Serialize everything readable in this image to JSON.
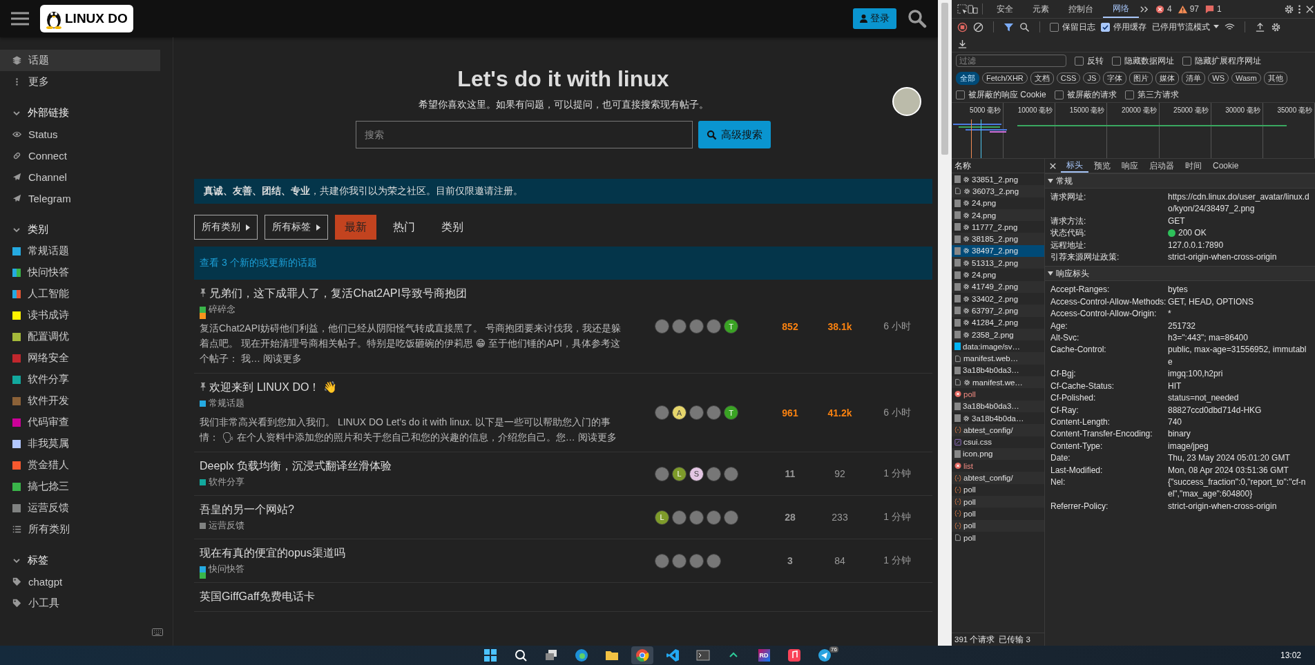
{
  "header": {
    "logo_text": "LINUX DO",
    "login_button": "登录"
  },
  "sidebar": {
    "items": [
      {
        "label": "话题",
        "kind": "layers",
        "selected": true
      },
      {
        "label": "更多",
        "kind": "dots",
        "selected": false
      }
    ],
    "sections": [
      {
        "title": "外部链接",
        "expanded": true,
        "items": [
          {
            "label": "Status",
            "kind": "eye"
          },
          {
            "label": "Connect",
            "kind": "link"
          },
          {
            "label": "Channel",
            "kind": "plane"
          },
          {
            "label": "Telegram",
            "kind": "plane"
          }
        ]
      },
      {
        "title": "类别",
        "expanded": true,
        "items": [
          {
            "label": "常规话题",
            "color": "#25aae1"
          },
          {
            "label": "快问快答",
            "stripes": [
              {
                "color": "#25aae1"
              },
              {
                "color": "#3ab54a"
              }
            ]
          },
          {
            "label": "人工智能",
            "stripes": [
              {
                "color": "#25aae1"
              },
              {
                "color": "#e45735"
              }
            ]
          },
          {
            "label": "读书成诗",
            "color": "#fff200"
          },
          {
            "label": "配置调优",
            "color": "#a4b83a"
          },
          {
            "label": "网络安全",
            "color": "#c1272d"
          },
          {
            "label": "软件分享",
            "color": "#12a89d"
          },
          {
            "label": "软件开发",
            "color": "#8c6238"
          },
          {
            "label": "代码审查",
            "color": "#cc0099"
          },
          {
            "label": "非我莫属",
            "color": "#b3c8ff"
          },
          {
            "label": "赏金猎人",
            "color": "#f7592f"
          },
          {
            "label": "搞七捻三",
            "color": "#3ab54a"
          },
          {
            "label": "运营反馈",
            "color": "#808281"
          },
          {
            "label": "所有类别",
            "kind": "list"
          }
        ]
      },
      {
        "title": "标签",
        "expanded": true,
        "items": [
          {
            "label": "chatgpt",
            "kind": "tag"
          },
          {
            "label": "小工具",
            "kind": "tag"
          }
        ]
      }
    ]
  },
  "hero": {
    "title": "Let's do it with linux",
    "subtitle": "希望你喜欢这里。如果有问题，可以提问，也可直接搜索现有帖子。",
    "search_placeholder": "搜索",
    "search_button": "高级搜索"
  },
  "banner": "**真诚、友善、团结、专业**，共建你我引以为荣之社区。目前仅限邀请注册。",
  "nav": {
    "dropdowns": [
      "所有类别",
      "所有标签"
    ],
    "tabs": [
      {
        "label": "最新",
        "selected": true
      },
      {
        "label": "热门",
        "selected": false
      },
      {
        "label": "类别",
        "selected": false
      }
    ]
  },
  "new_topics": "查看 3 个新的或更新的话题",
  "topics": [
    {
      "title": "兄弟们，这下成罪人了，复活Chat2API导致号商抱团",
      "pinned": true,
      "category": "碎碎念",
      "stripes": [
        {
          "color": "#3ab54a"
        },
        {
          "color": "#f7941d"
        }
      ],
      "excerpt": "复活Chat2API妨碍他们利益，他们已经从阴阳怪气转成直接黑了。 号商抱团要来讨伐我，我还是躲着点吧。 现在开始清理号商相关帖子。特别是吃饭砸碗的伊莉思 😁 至于他们锤的API，具体参考这个帖子： 我…",
      "read_more": "阅读更多",
      "avatars": [
        {
          "kind": "image"
        },
        {
          "kind": "image"
        },
        {
          "kind": "image"
        },
        {
          "kind": "image"
        },
        {
          "kind": "letter",
          "letter": "T",
          "color": "#3aa324"
        }
      ],
      "replies": "852",
      "views": "38.1k",
      "activity": "6 小时",
      "hot": true
    },
    {
      "title": "欢迎来到 LINUX DO！ 👋",
      "pinned": true,
      "category": "常规话题",
      "color": "#25aae1",
      "excerpt": "我们非常高兴看到您加入我们。 LINUX DO Let’s do it with linux. 以下是一些可以帮助您入门的事情： 🗣 在个人资料中添加您的照片和关于您自己和您的兴趣的信息，介绍您自己。您…",
      "read_more": "阅读更多",
      "avatars": [
        {
          "kind": "image"
        },
        {
          "kind": "letter",
          "letter": "A",
          "color": "#e5d56b"
        },
        {
          "kind": "image"
        },
        {
          "kind": "image"
        },
        {
          "kind": "letter",
          "letter": "T",
          "color": "#3aa324"
        }
      ],
      "replies": "961",
      "views": "41.2k",
      "activity": "6 小时",
      "hot": true
    },
    {
      "title": "Deeplx 负载均衡，沉浸式翻译丝滑体验",
      "pinned": false,
      "category": "软件分享",
      "color": "#12a89d",
      "avatars": [
        {
          "kind": "image"
        },
        {
          "kind": "letter",
          "letter": "L",
          "color": "#7e9b2a"
        },
        {
          "kind": "letter",
          "letter": "S",
          "color": "#e3c6e3"
        },
        {
          "kind": "image"
        },
        {
          "kind": "image"
        }
      ],
      "replies": "11",
      "views": "92",
      "activity": "1 分钟",
      "hot": false
    },
    {
      "title": "吾皇的另一个网站?",
      "pinned": false,
      "category": "运营反馈",
      "color": "#808281",
      "avatars": [
        {
          "kind": "letter",
          "letter": "L",
          "color": "#7e9b2a"
        },
        {
          "kind": "image"
        },
        {
          "kind": "image"
        },
        {
          "kind": "image"
        },
        {
          "kind": "image"
        }
      ],
      "replies": "28",
      "views": "233",
      "activity": "1 分钟",
      "hot": false
    },
    {
      "title": "现在有真的便宜的opus渠道吗",
      "pinned": false,
      "category": "快问快答",
      "stripes": [
        {
          "color": "#25aae1"
        },
        {
          "color": "#3ab54a"
        }
      ],
      "avatars": [
        {
          "kind": "image"
        },
        {
          "kind": "image"
        },
        {
          "kind": "image"
        },
        {
          "kind": "image"
        }
      ],
      "replies": "3",
      "views": "84",
      "activity": "1 分钟",
      "hot": false
    },
    {
      "title": "英国GiffGaff免费电话卡",
      "pinned": false
    }
  ],
  "devtools": {
    "tabs": [
      {
        "label": "安全",
        "selected": false
      },
      {
        "label": "元素",
        "selected": false
      },
      {
        "label": "控制台",
        "selected": false
      },
      {
        "label": "网络",
        "selected": true
      }
    ],
    "errors": "4",
    "warnings": "97",
    "issues": "1",
    "options": [
      {
        "label": "保留日志",
        "checked": false
      },
      {
        "label": "停用缓存",
        "checked": true
      }
    ],
    "throttling": "已停用节流模式",
    "filter_placeholder": "过滤",
    "filter_options": [
      {
        "label": "反转",
        "checked": false
      },
      {
        "label": "隐藏数据网址",
        "checked": false
      },
      {
        "label": "隐藏扩展程序网址",
        "checked": false
      }
    ],
    "types": [
      {
        "label": "全部",
        "selected": true
      },
      {
        "label": "Fetch/XHR",
        "selected": false
      },
      {
        "label": "文档",
        "selected": false
      },
      {
        "label": "CSS",
        "selected": false
      },
      {
        "label": "JS",
        "selected": false
      },
      {
        "label": "字体",
        "selected": false
      },
      {
        "label": "图片",
        "selected": false
      },
      {
        "label": "媒体",
        "selected": false
      },
      {
        "label": "清单",
        "selected": false
      },
      {
        "label": "WS",
        "selected": false
      },
      {
        "label": "Wasm",
        "selected": false
      },
      {
        "label": "其他",
        "selected": false
      }
    ],
    "more_filters": [
      {
        "label": "被屏蔽的响应 Cookie",
        "checked": false
      },
      {
        "label": "被屏蔽的请求",
        "checked": false
      },
      {
        "label": "第三方请求",
        "checked": false
      }
    ],
    "timeline_ticks": [
      "5000 毫秒",
      "10000 毫秒",
      "15000 毫秒",
      "20000 毫秒",
      "25000 毫秒",
      "30000 毫秒",
      "35000 毫秒"
    ],
    "name_column": "名称",
    "requests": [
      {
        "name": "33851_2.png",
        "kind": "image",
        "override": true,
        "selected": false
      },
      {
        "name": "36073_2.png",
        "kind": "file",
        "override": true,
        "selected": false
      },
      {
        "name": "24.png",
        "kind": "image",
        "override": true,
        "selected": false
      },
      {
        "name": "24.png",
        "kind": "image",
        "override": true,
        "selected": false
      },
      {
        "name": "11777_2.png",
        "kind": "image",
        "override": true,
        "selected": false
      },
      {
        "name": "38185_2.png",
        "kind": "image",
        "override": true,
        "selected": false
      },
      {
        "name": "38497_2.png",
        "kind": "image",
        "override": true,
        "selected": true
      },
      {
        "name": "51313_2.png",
        "kind": "image",
        "override": true,
        "selected": false
      },
      {
        "name": "24.png",
        "kind": "image",
        "override": true,
        "selected": false
      },
      {
        "name": "41749_2.png",
        "kind": "image",
        "override": true,
        "selected": false
      },
      {
        "name": "33402_2.png",
        "kind": "image",
        "override": true,
        "selected": false
      },
      {
        "name": "63797_2.png",
        "kind": "image",
        "override": true,
        "selected": false
      },
      {
        "name": "41284_2.png",
        "kind": "image",
        "override": true,
        "selected": false
      },
      {
        "name": "2358_2.png",
        "kind": "image",
        "override": true,
        "selected": false
      },
      {
        "name": "data:image/sv…",
        "kind": "svg",
        "override": false,
        "selected": false
      },
      {
        "name": "manifest.web…",
        "kind": "file",
        "override": false,
        "selected": false
      },
      {
        "name": "3a18b4b0da3…",
        "kind": "image",
        "override": false,
        "selected": false
      },
      {
        "name": "manifest.we…",
        "kind": "file",
        "override": true,
        "selected": false
      },
      {
        "name": "poll",
        "kind": "error",
        "override": false,
        "selected": false
      },
      {
        "name": "3a18b4b0da3…",
        "kind": "image",
        "override": false,
        "selected": false
      },
      {
        "name": "3a18b4b0da…",
        "kind": "image",
        "override": true,
        "selected": false
      },
      {
        "name": "abtest_config/",
        "kind": "fetch",
        "override": false,
        "selected": false
      },
      {
        "name": "csui.css",
        "kind": "css",
        "override": false,
        "selected": false
      },
      {
        "name": "icon.png",
        "kind": "image",
        "override": false,
        "selected": false
      },
      {
        "name": "list",
        "kind": "error",
        "override": false,
        "selected": false
      },
      {
        "name": "abtest_config/",
        "kind": "fetch",
        "override": false,
        "selected": false
      },
      {
        "name": "poll",
        "kind": "fetch",
        "override": false,
        "selected": false
      },
      {
        "name": "poll",
        "kind": "fetch",
        "override": false,
        "selected": false
      },
      {
        "name": "poll",
        "kind": "fetch",
        "override": false,
        "selected": false
      },
      {
        "name": "poll",
        "kind": "fetch",
        "override": false,
        "selected": false
      },
      {
        "name": "poll",
        "kind": "file",
        "override": false,
        "selected": false
      }
    ],
    "request_count": "391 个请求",
    "transferred": "已传输 3",
    "detail_tabs": [
      {
        "label": "标头",
        "selected": true
      },
      {
        "label": "预览",
        "selected": false
      },
      {
        "label": "响应",
        "selected": false
      },
      {
        "label": "启动器",
        "selected": false
      },
      {
        "label": "时间",
        "selected": false
      },
      {
        "label": "Cookie",
        "selected": false
      }
    ],
    "sections": [
      {
        "title": "常规",
        "expanded": true,
        "rows": [
          {
            "name": "请求网址:",
            "value": "https://cdn.linux.do/user_avatar/linux.do/kyon/24/38497_2.png"
          },
          {
            "name": "请求方法:",
            "value": "GET"
          },
          {
            "name": "状态代码:",
            "value": "200 OK",
            "color": "#2ec05a"
          },
          {
            "name": "远程地址:",
            "value": "127.0.0.1:7890"
          },
          {
            "name": "引荐来源网址政策:",
            "value": "strict-origin-when-cross-origin"
          }
        ]
      },
      {
        "title": "响应标头",
        "expanded": true,
        "rows": [
          {
            "name": "Accept-Ranges:",
            "value": "bytes"
          },
          {
            "name": "Access-Control-Allow-Methods:",
            "value": "GET, HEAD, OPTIONS"
          },
          {
            "name": "Access-Control-Allow-Origin:",
            "value": "*"
          },
          {
            "name": "Age:",
            "value": "251732"
          },
          {
            "name": "Alt-Svc:",
            "value": "h3=\":443\"; ma=86400"
          },
          {
            "name": "Cache-Control:",
            "value": "public, max-age=31556952, immutable"
          },
          {
            "name": "Cf-Bgj:",
            "value": "imgq:100,h2pri"
          },
          {
            "name": "Cf-Cache-Status:",
            "value": "HIT"
          },
          {
            "name": "Cf-Polished:",
            "value": "status=not_needed"
          },
          {
            "name": "Cf-Ray:",
            "value": "88827ccd0dbd714d-HKG"
          },
          {
            "name": "Content-Length:",
            "value": "740"
          },
          {
            "name": "Content-Transfer-Encoding:",
            "value": "binary"
          },
          {
            "name": "Content-Type:",
            "value": "image/jpeg"
          },
          {
            "name": "Date:",
            "value": "Thu, 23 May 2024 05:01:20 GMT"
          },
          {
            "name": "Last-Modified:",
            "value": "Mon, 08 Apr 2024 03:51:36 GMT"
          },
          {
            "name": "Nel:",
            "value": "{\"success_fraction\":0,\"report_to\":\"cf-nel\",\"max_age\":604800}"
          },
          {
            "name": "Referrer-Policy:",
            "value": "strict-origin-when-cross-origin"
          }
        ]
      }
    ]
  },
  "taskbar": {
    "apps": [
      {
        "kind": "start",
        "selected": false
      },
      {
        "kind": "search",
        "selected": false
      },
      {
        "kind": "taskview",
        "selected": false
      },
      {
        "kind": "edge",
        "selected": false
      },
      {
        "kind": "folder",
        "selected": false
      },
      {
        "kind": "chrome",
        "selected": true
      },
      {
        "kind": "code",
        "selected": false
      },
      {
        "kind": "terminal",
        "selected": false
      },
      {
        "kind": "caret",
        "selected": false
      },
      {
        "kind": "rider",
        "label": "RD",
        "selected": false
      },
      {
        "kind": "music",
        "selected": false
      },
      {
        "kind": "bird",
        "badge": "76",
        "selected": false
      }
    ],
    "clock": "13:02"
  }
}
